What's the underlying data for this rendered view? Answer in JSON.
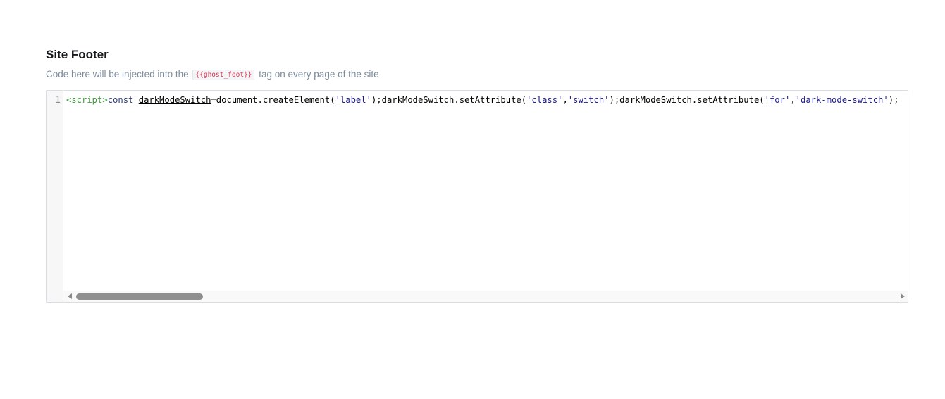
{
  "section": {
    "title": "Site Footer",
    "description_before": "Code here will be injected into the",
    "description_code": "{{ghost_foot}}",
    "description_after": "tag on every page of the site"
  },
  "editor": {
    "line_number": "1",
    "tokens": {
      "t1": "<script>",
      "t2": "const",
      "t3": " ",
      "t4": "darkModeSwitch",
      "t5": "=document.createElement(",
      "t6": "'label'",
      "t7": ");darkModeSwitch.setAttribute(",
      "t8": "'class'",
      "t9": ",",
      "t10": "'switch'",
      "t11": ");darkModeSwitch.setAttribute(",
      "t12": "'for'",
      "t13": ",",
      "t14": "'dark-mode-switch'",
      "t15": ");"
    },
    "scrollbar": {
      "position": 0
    }
  }
}
